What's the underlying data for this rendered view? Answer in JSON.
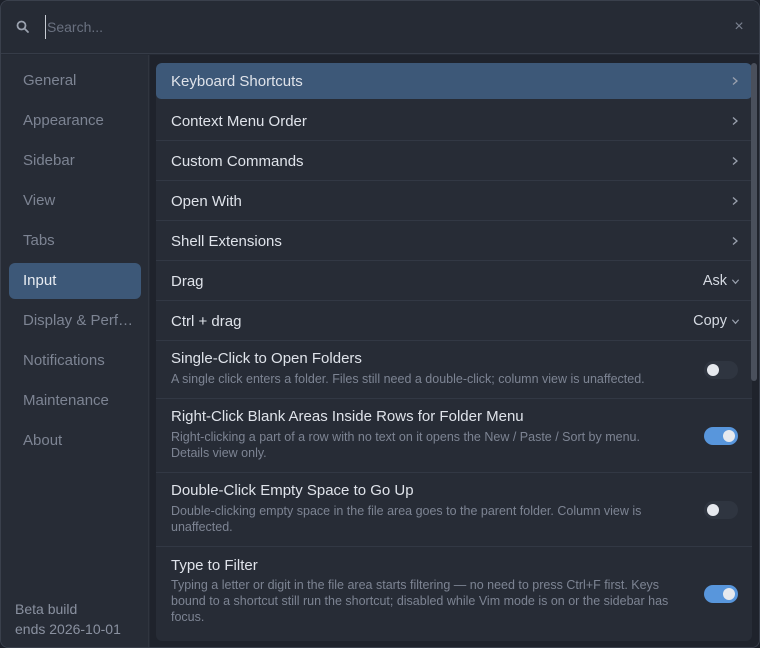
{
  "search": {
    "placeholder": "Search..."
  },
  "sidebar": {
    "items": [
      {
        "label": "General"
      },
      {
        "label": "Appearance"
      },
      {
        "label": "Sidebar"
      },
      {
        "label": "View"
      },
      {
        "label": "Tabs"
      },
      {
        "label": "Input",
        "active": true
      },
      {
        "label": "Display & Performance"
      },
      {
        "label": "Notifications"
      },
      {
        "label": "Maintenance"
      },
      {
        "label": "About"
      }
    ],
    "beta_line1": "Beta build",
    "beta_line2": "ends 2026-10-01"
  },
  "settings": {
    "nav": [
      {
        "label": "Keyboard Shortcuts"
      },
      {
        "label": "Context Menu Order"
      },
      {
        "label": "Custom Commands"
      },
      {
        "label": "Open With"
      },
      {
        "label": "Shell Extensions"
      }
    ],
    "drag": {
      "label": "Drag",
      "value": "Ask"
    },
    "ctrl_drag": {
      "label": "Ctrl + drag",
      "value": "Copy"
    },
    "single_click": {
      "label": "Single-Click to Open Folders",
      "desc": "A single click enters a folder. Files still need a double-click; column view is unaffected.",
      "enabled": false
    },
    "right_click": {
      "label": "Right-Click Blank Areas Inside Rows for Folder Menu",
      "desc": "Right-clicking a part of a row with no text on it opens the New / Paste / Sort by menu. Details view only.",
      "enabled": true
    },
    "double_click": {
      "label": "Double-Click Empty Space to Go Up",
      "desc": "Double-clicking empty space in the file area goes to the parent folder. Column view is unaffected.",
      "enabled": false
    },
    "type_filter": {
      "label": "Type to Filter",
      "desc": "Typing a letter or digit in the file area starts filtering — no need to press Ctrl+F first. Keys bound to a shortcut still run the shortcut; disabled while Vim mode is on or the sidebar has focus.",
      "enabled": true
    }
  },
  "colors": {
    "accent": "#5896dc",
    "selection": "#3d5878",
    "panel": "#272c36"
  },
  "icons": {
    "search": "search-icon",
    "close": "close-icon",
    "chevron": "chevron-right-icon",
    "dropdown": "chevron-down-icon"
  }
}
